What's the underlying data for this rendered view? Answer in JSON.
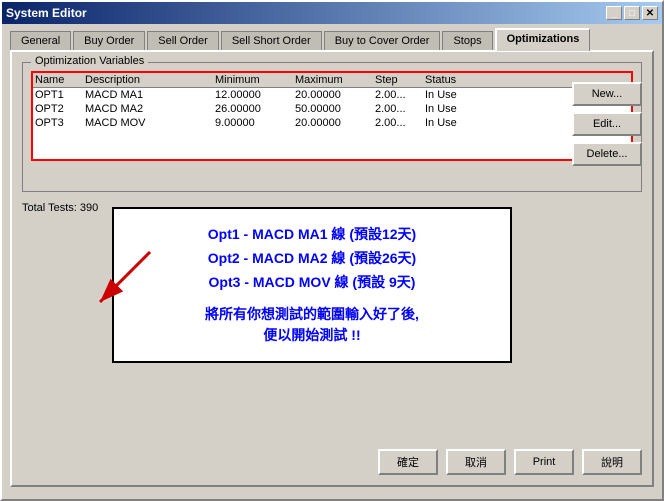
{
  "window": {
    "title": "System Editor",
    "close_button": "✕"
  },
  "tabs": [
    {
      "label": "General",
      "active": false
    },
    {
      "label": "Buy Order",
      "active": false
    },
    {
      "label": "Sell Order",
      "active": false
    },
    {
      "label": "Sell Short Order",
      "active": false
    },
    {
      "label": "Buy to Cover Order",
      "active": false
    },
    {
      "label": "Stops",
      "active": false
    },
    {
      "label": "Optimizations",
      "active": true
    }
  ],
  "group_box": {
    "label": "Optimization Variables"
  },
  "table": {
    "headers": [
      "Name",
      "Description",
      "Minimum",
      "Maximum",
      "Step",
      "Status"
    ],
    "rows": [
      {
        "name": "OPT1",
        "description": "MACD MA1",
        "minimum": "12.00000",
        "maximum": "20.00000",
        "step": "2.00...",
        "status": "In Use"
      },
      {
        "name": "OPT2",
        "description": "MACD MA2",
        "minimum": "26.00000",
        "maximum": "50.00000",
        "step": "2.00...",
        "status": "In Use"
      },
      {
        "name": "OPT3",
        "description": "MACD MOV",
        "minimum": "9.00000",
        "maximum": "20.00000",
        "step": "2.00...",
        "status": "In Use"
      }
    ]
  },
  "right_buttons": {
    "new": "New...",
    "edit": "Edit...",
    "delete": "Delete..."
  },
  "total_tests": "Total Tests: 390",
  "annotation": {
    "line1": "Opt1 - MACD MA1 線 (預設12天)",
    "line2": "Opt2 - MACD MA2 線 (預設26天)",
    "line3": "Opt3 - MACD MOV 線 (預設 9天)",
    "note1": "將所有你想測試的範圍輸入好了後,",
    "note2": "便以開始測試 !!"
  },
  "bottom_buttons": {
    "confirm": "確定",
    "cancel": "取消",
    "print": "Print",
    "help": "說明"
  }
}
